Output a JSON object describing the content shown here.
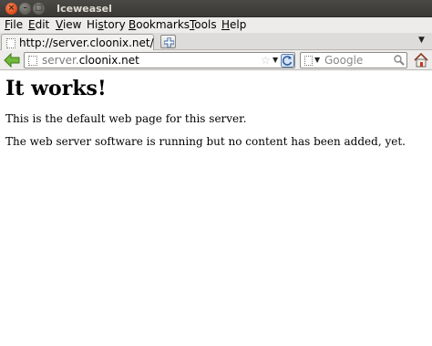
{
  "window": {
    "title": "Iceweasel",
    "close_glyph": "×",
    "min_glyph": "–",
    "max_glyph": "□"
  },
  "menu": {
    "items": [
      {
        "mnemonic": "F",
        "rest": "ile"
      },
      {
        "mnemonic": "E",
        "rest": "dit"
      },
      {
        "mnemonic": "V",
        "rest": "iew"
      },
      {
        "pre": "Hi",
        "mnemonic": "s",
        "rest": "tory"
      },
      {
        "mnemonic": "B",
        "rest": "ookmarks"
      },
      {
        "mnemonic": "T",
        "rest": "ools"
      },
      {
        "mnemonic": "H",
        "rest": "elp"
      }
    ]
  },
  "tabs": {
    "active_label": "http://server.cloonix.net/",
    "list_glyph": "▼"
  },
  "navbar": {
    "url_prefix": "server.",
    "url_domain": "cloonix.net",
    "star_glyph": "☆",
    "drop_glyph": "▼",
    "search_placeholder": "Google",
    "search_drop_glyph": "▼"
  },
  "page": {
    "heading": "It works!",
    "paragraph1": "This is the default web page for this server.",
    "paragraph2": "The web server software is running but no content has been added, yet."
  },
  "colors": {
    "accent_close": "#dd4814",
    "titlebar": "#3c3b37",
    "back_arrow": "#5aa02c"
  }
}
